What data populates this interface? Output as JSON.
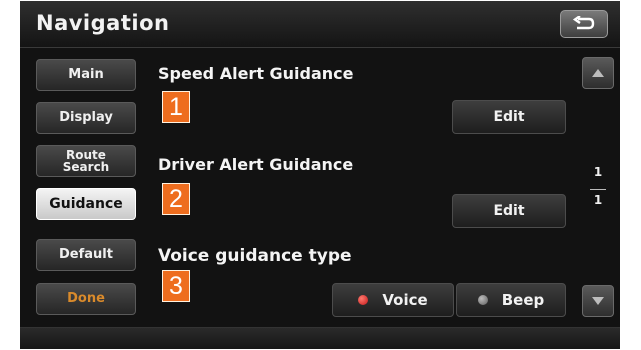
{
  "window": {
    "title": "Navigation"
  },
  "sidebar": {
    "items": [
      {
        "label": "Main"
      },
      {
        "label": "Display"
      },
      {
        "label": "Route\nSearch"
      },
      {
        "label": "Guidance"
      },
      {
        "label": "Default"
      },
      {
        "label": "Done"
      }
    ],
    "active_item": "Guidance"
  },
  "sections": [
    {
      "title": "Speed Alert Guidance",
      "badge": "1",
      "button_label": "Edit"
    },
    {
      "title": "Driver Alert Guidance",
      "badge": "2",
      "button_label": "Edit"
    },
    {
      "title": "Voice guidance type",
      "badge": "3",
      "options": [
        {
          "label": "Voice",
          "selected": true
        },
        {
          "label": "Beep",
          "selected": false
        }
      ]
    }
  ],
  "pager": {
    "current": "1",
    "total": "1"
  },
  "icons": {
    "back": "back-arrow-icon",
    "scroll_up": "triangle-up-icon",
    "scroll_down": "triangle-down-icon",
    "radio_selected": "radio-dot-red-icon",
    "radio_unselected": "radio-dot-grey-icon"
  },
  "colors": {
    "badge": "#ee6d1e",
    "done_text": "#d98a2b",
    "radio_selected": "#e0302a",
    "radio_unselected": "#8a8a8a",
    "active_tab_bg": "#e6e6e6"
  }
}
